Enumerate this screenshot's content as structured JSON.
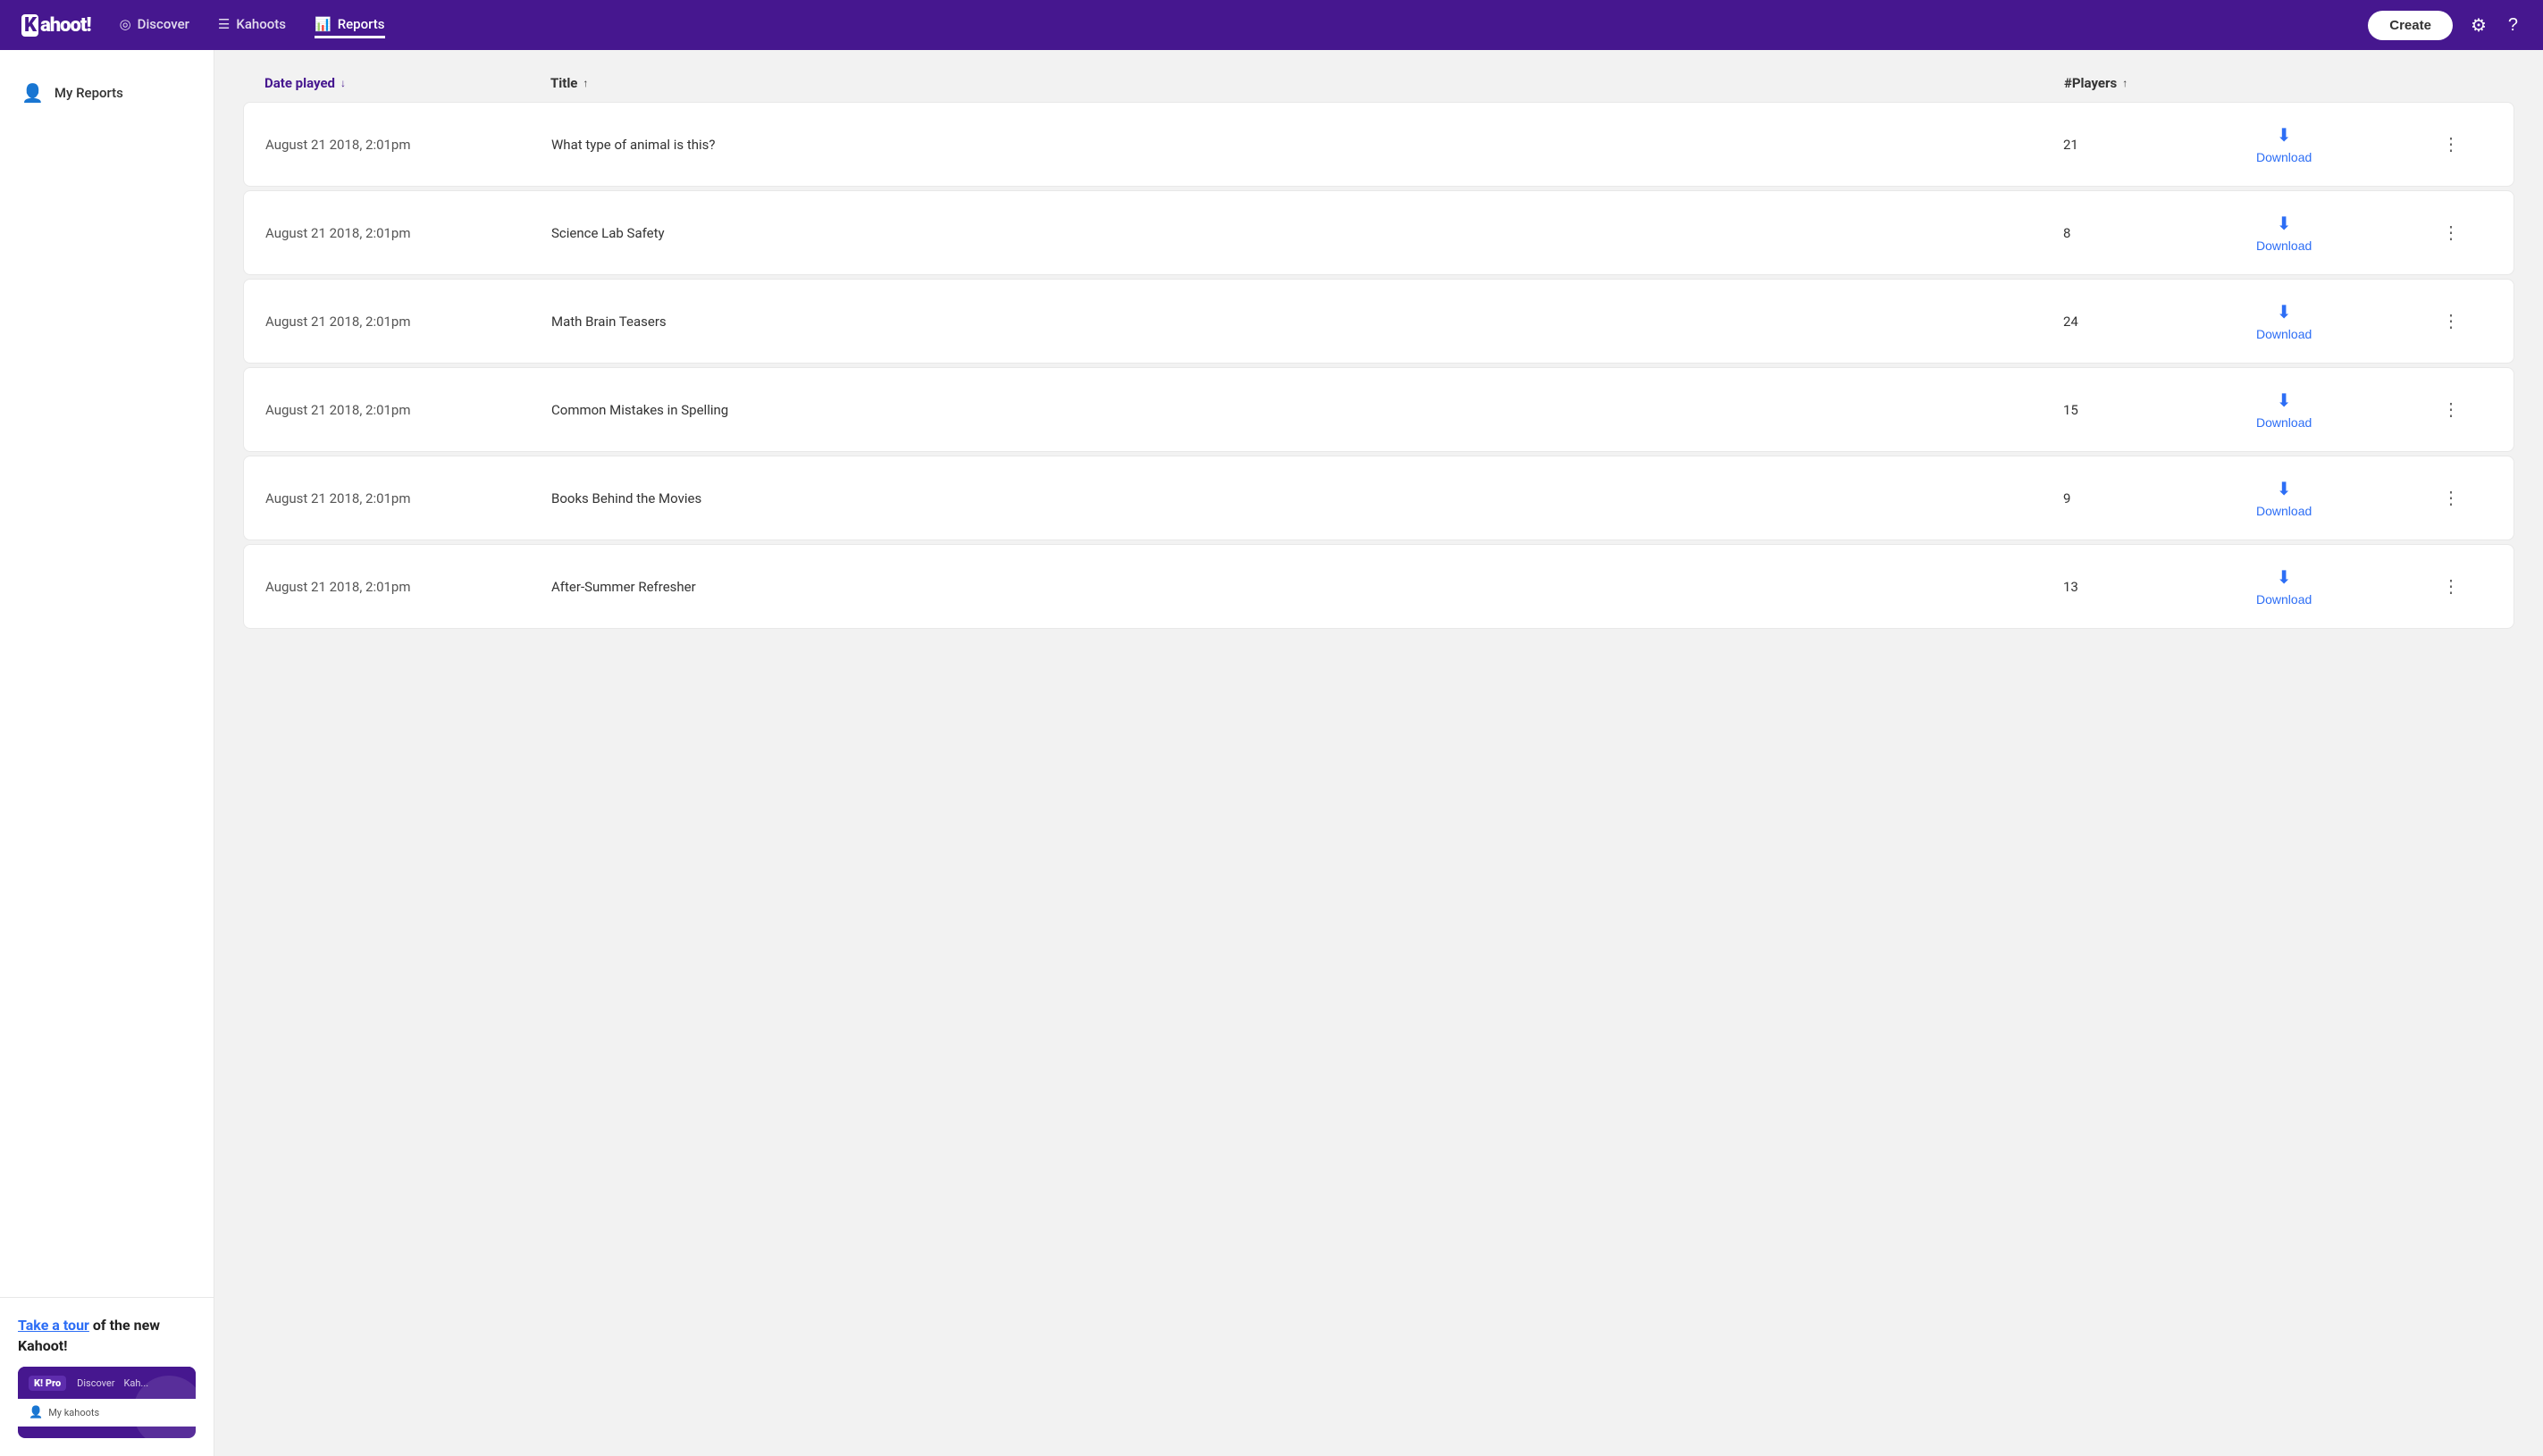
{
  "brand": {
    "name": "Kahoot",
    "exclamation": "!"
  },
  "navbar": {
    "items": [
      {
        "label": "Discover",
        "icon": "◎",
        "active": false
      },
      {
        "label": "Kahoots",
        "icon": "☰",
        "active": false
      },
      {
        "label": "Reports",
        "icon": "📊",
        "active": true
      }
    ],
    "create_label": "Create",
    "settings_icon": "⚙",
    "help_icon": "?"
  },
  "sidebar": {
    "my_reports_label": "My Reports",
    "person_icon": "👤"
  },
  "promo": {
    "title_text": "Take a tour",
    "title_suffix": " of the new Kahoot!",
    "bar_logo": "K! Pro",
    "nav_items": [
      "Discover",
      "Kah..."
    ],
    "content_label": "My kahoots"
  },
  "table": {
    "headers": [
      {
        "label": "Date played",
        "sort": "↓",
        "active": true
      },
      {
        "label": "Title",
        "sort": "↑",
        "active": false
      },
      {
        "label": "#Players",
        "sort": "↑",
        "active": false
      }
    ],
    "rows": [
      {
        "date": "August 21 2018, 2:01pm",
        "title": "What type of animal is this?",
        "players": "21",
        "download_label": "Download"
      },
      {
        "date": "August 21 2018, 2:01pm",
        "title": "Science Lab Safety",
        "players": "8",
        "download_label": "Download"
      },
      {
        "date": "August 21 2018, 2:01pm",
        "title": "Math Brain Teasers",
        "players": "24",
        "download_label": "Download"
      },
      {
        "date": "August 21 2018, 2:01pm",
        "title": "Common Mistakes in Spelling",
        "players": "15",
        "download_label": "Download"
      },
      {
        "date": "August 21 2018, 2:01pm",
        "title": "Books Behind the Movies",
        "players": "9",
        "download_label": "Download"
      },
      {
        "date": "August 21 2018, 2:01pm",
        "title": "After-Summer Refresher",
        "players": "13",
        "download_label": "Download"
      }
    ]
  }
}
